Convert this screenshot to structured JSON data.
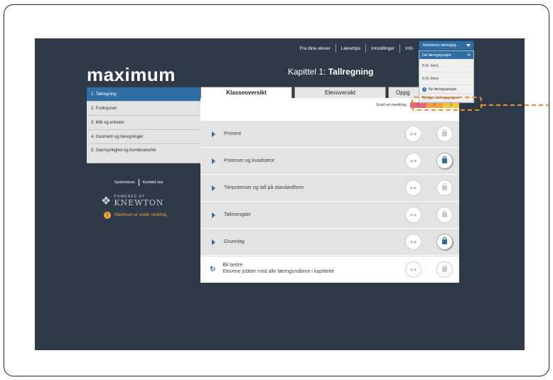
{
  "nav": {
    "items": [
      "Fra dine elever",
      "Lærertips",
      "Innstillinger",
      "Info"
    ]
  },
  "logo": "maximum",
  "chapter": {
    "prefix": "Kapittel 1: ",
    "name": "Tallregning"
  },
  "menu": {
    "items": [
      {
        "label": "1. Tallregning"
      },
      {
        "label": "2. Funksjoner"
      },
      {
        "label": "3. Mål og enheter"
      },
      {
        "label": "4. Geometri og beregninger"
      },
      {
        "label": "5. Sannsynlighet og kombinatorikk"
      }
    ]
  },
  "footer": {
    "systemkrav": "Systemkrav",
    "kontakt": "Kontakt oss",
    "powered_by": "POWERED BY",
    "knewton": "KNEWTON",
    "dev_note": "Maximum er under utvikling"
  },
  "tabs": [
    "Klasseoversikt",
    "Elevoversikt",
    "Oppg"
  ],
  "mastery": {
    "label": "Grad av mestring:",
    "levels": [
      "1",
      "2",
      "3"
    ]
  },
  "rows": [
    {
      "label": "Prosent"
    },
    {
      "label": "Potenser og kvadratrot"
    },
    {
      "label": "Tierpotenser og tall på standardform"
    },
    {
      "label": "Tallmengder"
    },
    {
      "label": "Grunnlag"
    }
  ],
  "bli_bedre": {
    "title": "Bli bedre",
    "subtitle": "Elevene jobber med alle læringsmålene i kapittelet"
  },
  "dropdown": {
    "selected": "Maximum læringsg...",
    "items": [
      "Del læringsgruppe",
      "8 (8. trinn)",
      "9 (9. trinn)",
      "Ny læringsgruppe",
      "Rediger læringsgrupper"
    ]
  },
  "colors": {
    "background": "#2f3a48",
    "accent": "#2f6ea4",
    "highlight": "#ef8b2a",
    "mastery_1": "#e9657a",
    "mastery_2": "#f2a240",
    "mastery_3": "#f5c542"
  },
  "icons": {
    "group": "group-icon",
    "lock": "lock-icon",
    "play": "play-icon",
    "refresh": "refresh-icon",
    "warning": "warning-icon"
  }
}
